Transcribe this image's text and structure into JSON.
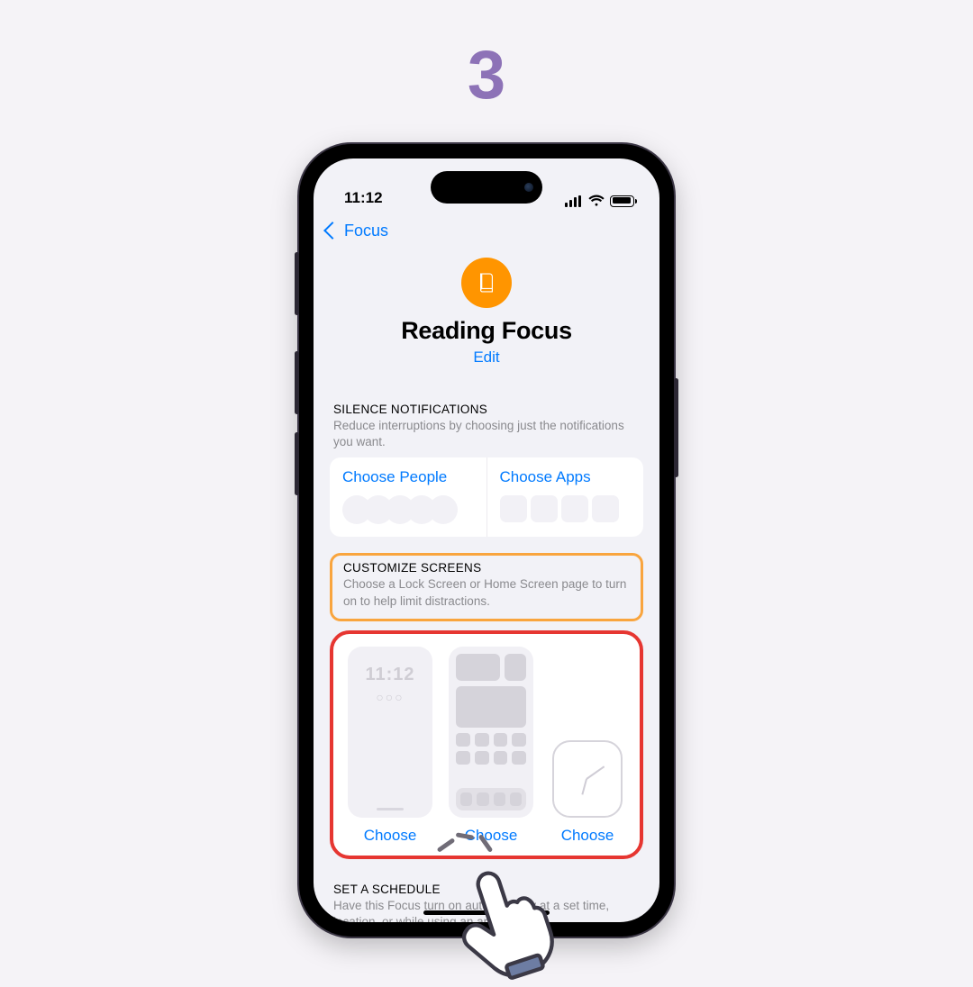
{
  "step": "3",
  "status": {
    "time": "11:12"
  },
  "nav": {
    "back_label": "Focus"
  },
  "hero": {
    "title": "Reading Focus",
    "edit": "Edit"
  },
  "silence": {
    "header": "SILENCE NOTIFICATIONS",
    "desc": "Reduce interruptions by choosing just the notifications you want.",
    "choose_people": "Choose People",
    "choose_apps": "Choose Apps"
  },
  "customize": {
    "header": "CUSTOMIZE SCREENS",
    "desc": "Choose a Lock Screen or Home Screen page to turn on to help limit distractions.",
    "lock_time": "11:12",
    "lock_dots": "○○○",
    "choose1": "Choose",
    "choose2": "Choose",
    "choose3": "Choose"
  },
  "schedule": {
    "header": "SET A SCHEDULE",
    "desc": "Have this Focus turn on automatically at a set time, location, or while using an app."
  }
}
